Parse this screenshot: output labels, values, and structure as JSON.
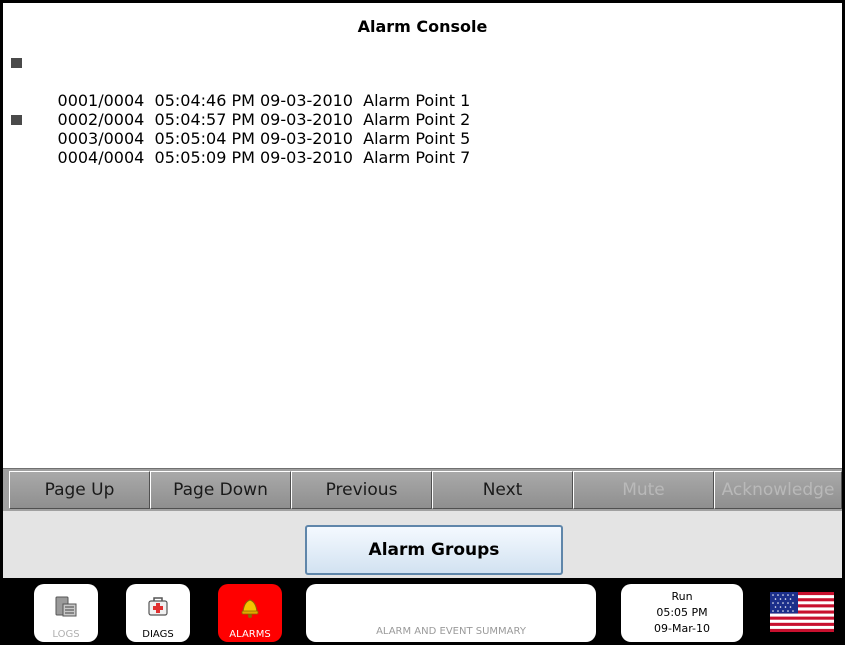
{
  "window": {
    "title": "Alarm Console"
  },
  "alarms": [
    {
      "text": "0001/0004  05:04:46 PM 09-03-2010  Alarm Point 1",
      "unacknowledged": true
    },
    {
      "text": "0002/0004  05:04:57 PM 09-03-2010  Alarm Point 2",
      "unacknowledged": false
    },
    {
      "text": "0003/0004  05:05:04 PM 09-03-2010  Alarm Point 5",
      "unacknowledged": false
    },
    {
      "text": "0004/0004  05:05:09 PM 09-03-2010  Alarm Point 7",
      "unacknowledged": true
    }
  ],
  "toolbar": {
    "page_up": "Page Up",
    "page_down": "Page Down",
    "previous": "Previous",
    "next": "Next",
    "mute": "Mute",
    "acknowledge": "Acknowledge"
  },
  "groups": {
    "label": "Alarm Groups"
  },
  "taskbar": {
    "logs": "LOGS",
    "diags": "DIAGS",
    "alarms": "ALARMS",
    "summary": "ALARM AND EVENT SUMMARY",
    "status": {
      "mode": "Run",
      "time": "05:05 PM",
      "date": "09-Mar-10"
    }
  },
  "icons": {
    "logs": "computer-icon",
    "diags": "medical-kit-icon",
    "alarms": "bell-icon",
    "language": "us-flag-icon"
  },
  "colors": {
    "alarms_active": "#ff0000",
    "button_face": "#9e9e9e",
    "groups_border": "#5f86aa"
  }
}
